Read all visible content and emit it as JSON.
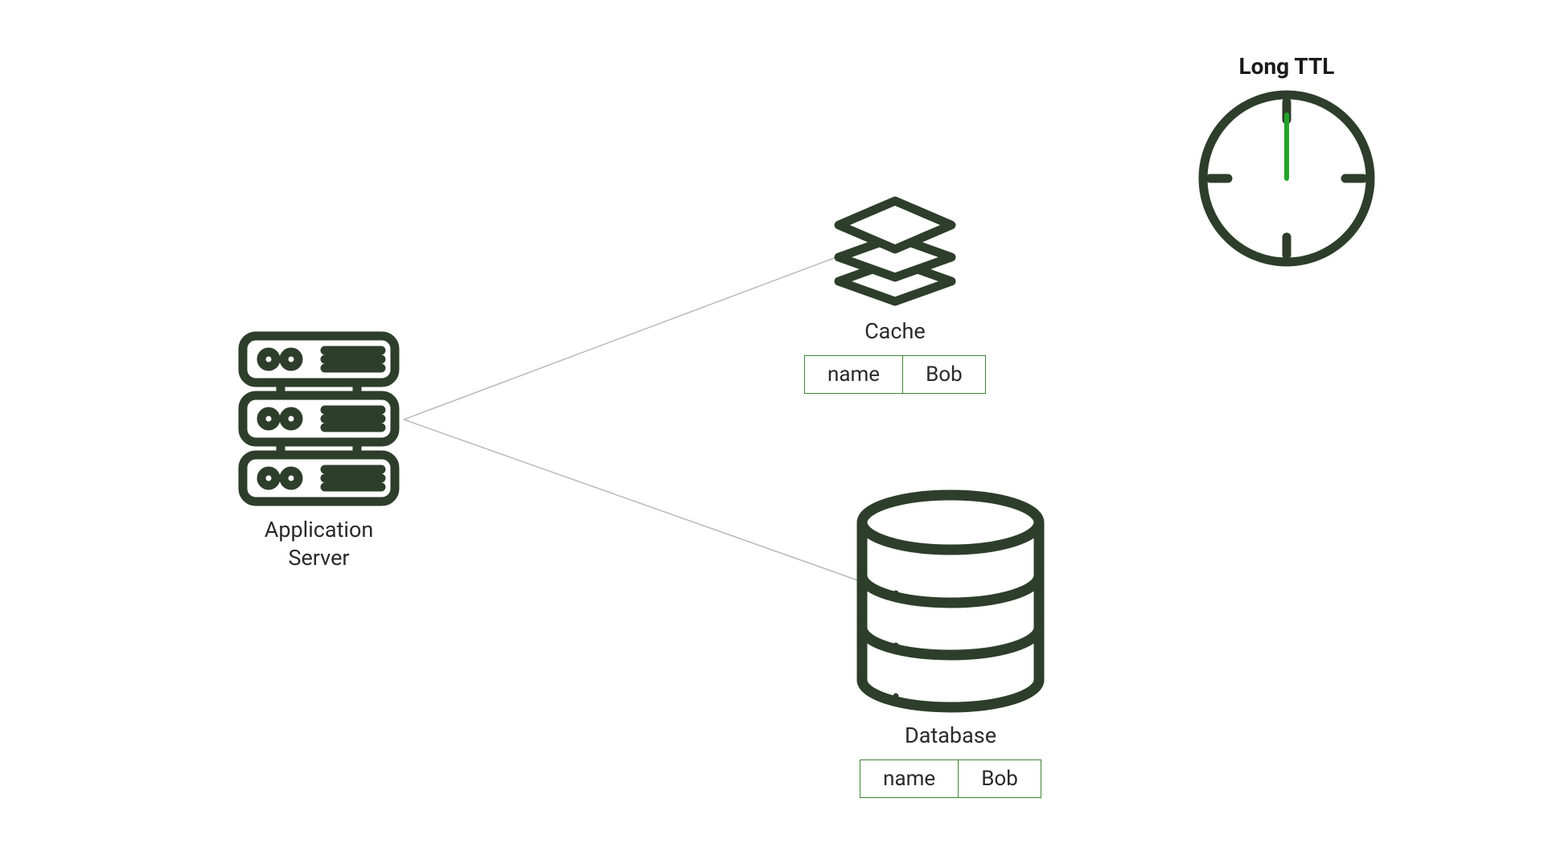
{
  "colors": {
    "stroke": "#2d3e2a",
    "accent": "#3e8536",
    "text": "#2a2a2a",
    "connector": "#b9b9b9"
  },
  "app_server": {
    "label_line1": "Application",
    "label_line2": "Server"
  },
  "cache": {
    "label": "Cache",
    "kv": {
      "key": "name",
      "value": "Bob"
    }
  },
  "database": {
    "label": "Database",
    "kv": {
      "key": "name",
      "value": "Bob"
    }
  },
  "ttl": {
    "label": "Long TTL"
  }
}
